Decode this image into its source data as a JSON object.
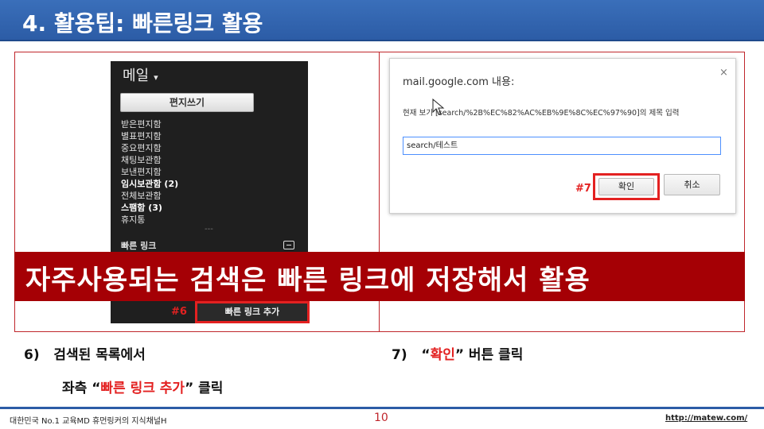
{
  "slide": {
    "title": "4. 활용팁: 빠른링크 활용"
  },
  "gmail_sidebar": {
    "mail_label": "메일",
    "mail_caret": "▾",
    "compose_button": "편지쓰기",
    "folders": [
      {
        "label": "받은편지함",
        "bold": false
      },
      {
        "label": "별표편지함",
        "bold": false
      },
      {
        "label": "중요편지함",
        "bold": false
      },
      {
        "label": "채팅보관함",
        "bold": false
      },
      {
        "label": "보낸편지함",
        "bold": false
      },
      {
        "label": "임시보관함 (2)",
        "bold": true
      },
      {
        "label": "전체보관함",
        "bold": false
      },
      {
        "label": "스팸함 (3)",
        "bold": true
      },
      {
        "label": "휴지통",
        "bold": false
      }
    ],
    "separator": "---",
    "quick_links_label": "빠른 링크",
    "add_quick_link_button": "빠른 링크 추가",
    "step_tag": "#6"
  },
  "dialog": {
    "title": "mail.google.com 내용:",
    "close_glyph": "×",
    "message": "현재 보기 [search/%2B%EC%82%AC%EB%9E%8C%EC%97%90]의 제목 입력",
    "input_value": "search/테스트",
    "ok_button": "확인",
    "cancel_button": "취소",
    "step_tag": "#7"
  },
  "banner": {
    "text": "자주사용되는 검색은 빠른 링크에 저장해서 활용"
  },
  "captions": {
    "step6_number": "6)",
    "step6_line1": "검색된 목록에서",
    "step6_line2_prefix": "좌측 “",
    "step6_line2_highlight": "빠른 링크 추가",
    "step6_line2_suffix": "” 클릭",
    "step7_number": "7)",
    "step7_prefix": "“",
    "step7_highlight": "확인",
    "step7_suffix": "” 버튼 클릭"
  },
  "footer": {
    "left_text": "대한민국 No.1 교육MD 휴먼링커의 지식채널H",
    "page_number": "10",
    "url": "http://matew.com/"
  },
  "colors": {
    "title_bar": "#2c5ca6",
    "frame_border": "#c0262c",
    "banner": "#a50005",
    "highlight_red": "#e32121",
    "gmail_bg": "#1f1f1f"
  }
}
